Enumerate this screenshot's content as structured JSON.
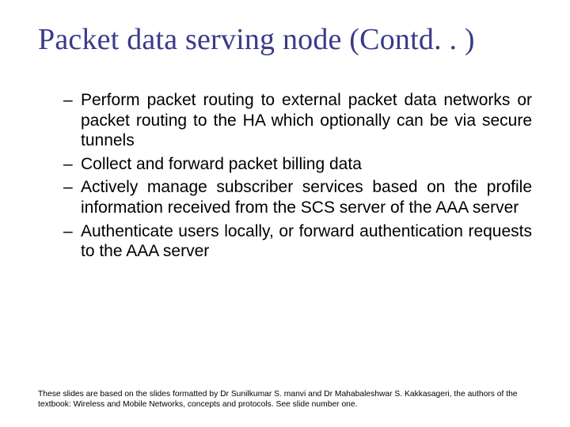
{
  "title": "Packet data serving node (Contd. . )",
  "bullets": [
    "Perform packet routing to external packet data networks or packet routing to the HA which optionally can be via secure tunnels",
    "Collect and forward packet billing data",
    "Actively manage subscriber services based on the profile information received from the SCS server of the AAA server",
    "Authenticate users locally, or forward authentication requests to the AAA server"
  ],
  "footer": "These slides are based on the slides formatted by Dr Sunilkumar S. manvi and Dr Mahabaleshwar S. Kakkasageri, the authors of the textbook: Wireless and Mobile Networks, concepts and protocols. See slide number one."
}
